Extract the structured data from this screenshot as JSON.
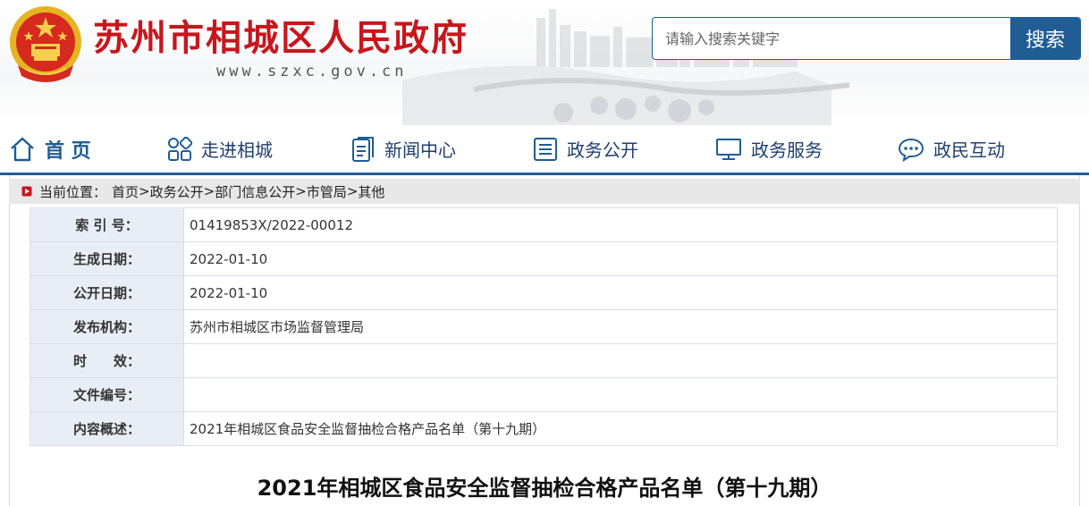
{
  "header": {
    "site_title": "苏州市相城区人民政府",
    "site_domain": "www.szxc.gov.cn",
    "search": {
      "placeholder": "请输入搜索关键字",
      "button_label": "搜索"
    }
  },
  "nav": {
    "items": [
      {
        "label": "首 页",
        "icon": "home-icon",
        "active": true
      },
      {
        "label": "走进相城",
        "icon": "grid-icon",
        "active": false
      },
      {
        "label": "新闻中心",
        "icon": "document-icon",
        "active": false
      },
      {
        "label": "政务公开",
        "icon": "list-icon",
        "active": false
      },
      {
        "label": "政务服务",
        "icon": "monitor-icon",
        "active": false
      },
      {
        "label": "政民互动",
        "icon": "chat-bubble-icon",
        "active": false
      }
    ]
  },
  "breadcrumb": {
    "prefix": "当前位置：",
    "items": [
      "首页",
      "政务公开",
      "部门信息公开",
      "市管局",
      "其他"
    ],
    "separator": ">"
  },
  "meta": {
    "rows": [
      {
        "label": "索 引 号：",
        "value": "01419853X/2022-00012"
      },
      {
        "label": "生成日期：",
        "value": "2022-01-10"
      },
      {
        "label": "公开日期：",
        "value": "2022-01-10"
      },
      {
        "label": "发布机构：",
        "value": "苏州市相城区市场监督管理局"
      },
      {
        "label": "时　　效：",
        "value": ""
      },
      {
        "label": "文件编号：",
        "value": ""
      },
      {
        "label": "内容概述：",
        "value": "2021年相城区食品安全监督抽检合格产品名单（第十九期）"
      }
    ]
  },
  "document": {
    "title": "2021年相城区食品安全监督抽检合格产品名单（第十九期）"
  },
  "colors": {
    "brand_red": "#c8161d",
    "brand_blue": "#1f5d94",
    "label_bg": "#e9eef6",
    "breadcrumb_bg": "#e8e8e8"
  }
}
